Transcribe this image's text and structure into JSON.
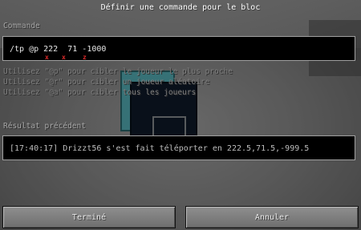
{
  "dialog": {
    "title": "Définir une commande pour le bloc",
    "command_label": "Commande",
    "command_value": "/tp @p 222  71 -1000",
    "axis_markers": [
      "x",
      "x",
      "z"
    ],
    "hints": [
      "Utilisez \"@p\" pour cibler le joueur le plus proche",
      "Utilisez \"@r\" pour cibler un joueur aléatoire",
      "Utilisez \"@a\" pour cibler tous les joueurs"
    ],
    "result_label": "Résultat précédent",
    "result_value": "[17:40:17] Drizzt56 s'est fait téléporter en 222.5,71.5,-999.5",
    "buttons": {
      "done": "Terminé",
      "cancel": "Annuler"
    }
  },
  "colors": {
    "axis_marker": "#e02a2a",
    "field_bg": "#000000",
    "field_border": "#a0a0a0"
  }
}
